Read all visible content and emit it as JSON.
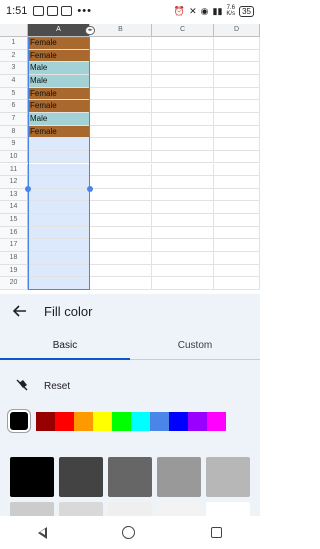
{
  "status_bar": {
    "time": "1:51",
    "left_icons": [
      "gallery-icon",
      "image-icon",
      "gallery-icon"
    ],
    "overflow": "•••",
    "net_speed_value": "7.6",
    "net_speed_unit": "K/s",
    "battery": "35"
  },
  "sheet": {
    "columns": [
      "A",
      "B",
      "C",
      "D"
    ],
    "selected_column": "A",
    "row_numbers": [
      "1",
      "2",
      "3",
      "4",
      "5",
      "6",
      "7",
      "8",
      "9",
      "10",
      "11",
      "12",
      "13",
      "14",
      "15",
      "16",
      "17",
      "18",
      "19",
      "20"
    ],
    "col_a_values": [
      "Female",
      "Female",
      "Male",
      "Male",
      "Female",
      "Female",
      "Male",
      "Female",
      "",
      "",
      "",
      "",
      "",
      "",
      "",
      "",
      "",
      "",
      "",
      ""
    ],
    "fill_colors": {
      "female": "#a8682e",
      "male": "#a2d2d6",
      "selection": "#dce8fc"
    }
  },
  "panel": {
    "title": "Fill color",
    "tabs": [
      "Basic",
      "Custom"
    ],
    "active_tab": "Basic",
    "reset_label": "Reset",
    "bright_colors": [
      "#000000",
      "#980000",
      "#ff0000",
      "#ff9900",
      "#ffff00",
      "#00ff00",
      "#00ffff",
      "#4a86e8",
      "#0000ff",
      "#9900ff",
      "#ff00ff"
    ],
    "grey_colors": [
      "#000000",
      "#434343",
      "#666666",
      "#999999",
      "#b7b7b7",
      "#cccccc",
      "#d9d9d9",
      "#efefef",
      "#f3f3f3",
      "#ffffff"
    ]
  }
}
